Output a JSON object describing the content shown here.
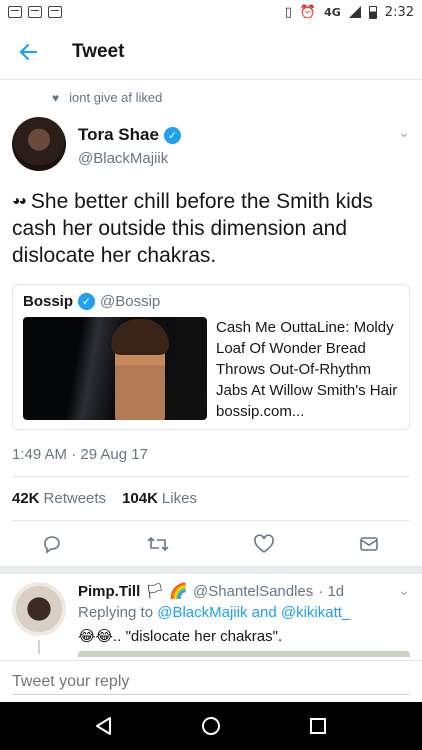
{
  "status_bar": {
    "network": "4G",
    "time": "2:32"
  },
  "app_bar": {
    "title": "Tweet"
  },
  "tweet": {
    "liked_by": "iont give af liked",
    "author_name": "Tora Shae",
    "author_handle": "@BlackMajiik",
    "text": "She better chill before the Smith kids cash her outside this dimension and dislocate her chakras.",
    "quote": {
      "name": "Bossip",
      "handle": "@Bossip",
      "text": "Cash Me OuttaLine: Moldy Loaf Of Wonder Bread Throws Out-Of-Rhythm Jabs At Willow Smith's Hair bossip.com..."
    },
    "timestamp": "1:49 AM · 29 Aug 17",
    "retweets_count": "42K",
    "retweets_label": "Retweets",
    "likes_count": "104K",
    "likes_label": "Likes"
  },
  "reply": {
    "name": "Pimp.Till",
    "handle": "@ShantelSandles",
    "age": "· 1d",
    "replying_prefix": "Replying to",
    "mention1": "@BlackMajiik",
    "and_word": "and",
    "mention2": "@kikikatt_",
    "text": "\"dislocate her chakras\"."
  },
  "composer": {
    "placeholder": "Tweet your reply"
  },
  "colors": {
    "accent": "#1da1f2",
    "secondary_text": "#657786",
    "divider": "#e1e8ed"
  }
}
